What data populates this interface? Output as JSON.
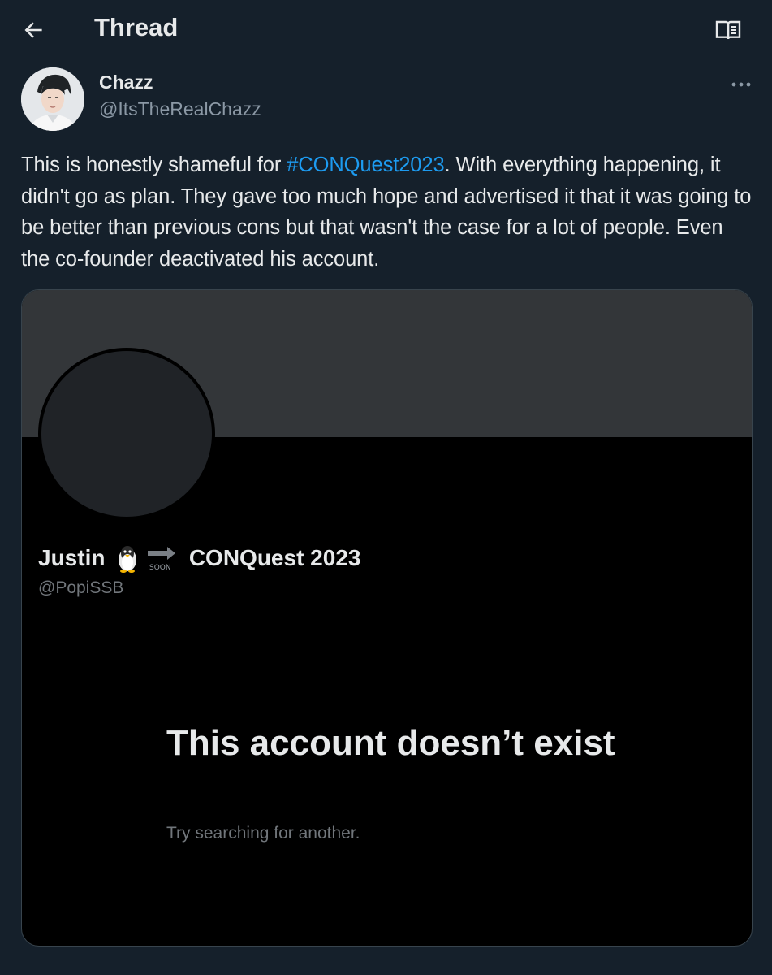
{
  "header": {
    "title": "Thread"
  },
  "author": {
    "display_name": "Chazz",
    "handle": "@ItsTheRealChazz"
  },
  "tweet": {
    "text_before": "This is honestly shameful for ",
    "hashtag": "#CONQuest2023",
    "text_after": ". With everything happening, it didn't go as plan. They gave too much hope and advertised it that it was going to be better than previous cons but that wasn't the case for a lot of people. Even the co-founder deactivated his account."
  },
  "media": {
    "profile_name": "Justin",
    "emoji_label": "SOON",
    "event_name": "CONQuest 2023",
    "profile_handle": "@PopiSSB",
    "headline": "This account doesn’t exist",
    "subtext": "Try searching for another."
  },
  "icons": {
    "back": "arrow-left-icon",
    "reader": "reader-mode-icon",
    "more": "more-horizontal-icon",
    "penguin": "penguin-icon",
    "soon": "soon-arrow-icon"
  },
  "colors": {
    "background": "#15202b",
    "text": "#e7e9ea",
    "secondary": "#8b98a5",
    "link": "#1d9bf0"
  }
}
